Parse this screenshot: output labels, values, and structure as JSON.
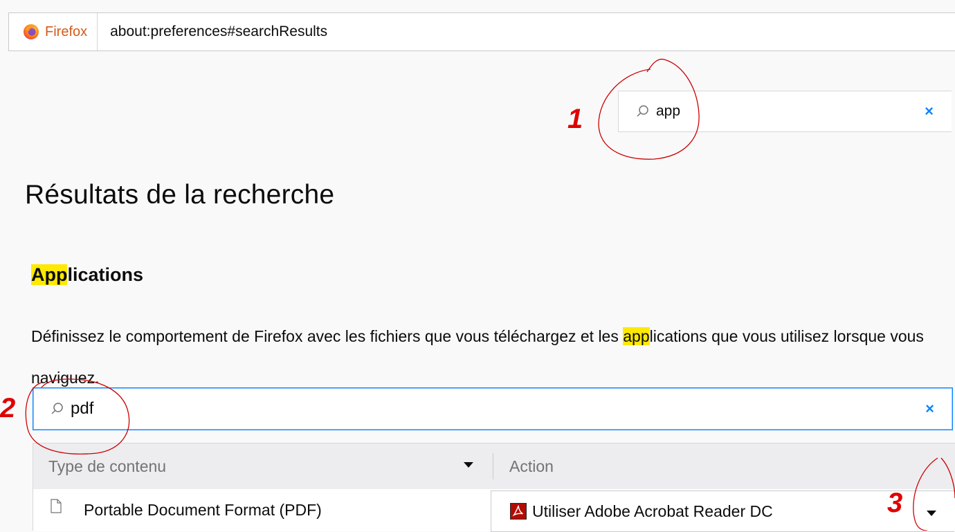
{
  "urlbar": {
    "identity_label": "Firefox",
    "url": "about:preferences#searchResults"
  },
  "top_search": {
    "value": "app",
    "icon": "search-icon",
    "clear_icon": "close-icon"
  },
  "page": {
    "heading": "Résultats de la recherche"
  },
  "section": {
    "title_highlight": "App",
    "title_rest": "lications",
    "description_part1": "Définissez le comportement de Firefox avec les fichiers que vous téléchargez et les ",
    "description_highlight": "app",
    "description_part2": "lications que vous utilisez lorsque vous naviguez."
  },
  "filter": {
    "value": "pdf",
    "icon": "search-icon",
    "clear_icon": "close-icon"
  },
  "table": {
    "headers": {
      "type": "Type de contenu",
      "action": "Action"
    },
    "rows": [
      {
        "type": "Portable Document Format (PDF)",
        "action": "Utiliser Adobe Acrobat Reader DC",
        "type_icon": "file-icon",
        "action_icon": "acrobat-icon"
      }
    ]
  },
  "annotations": [
    "1",
    "2",
    "3"
  ],
  "colors": {
    "highlight": "#ffe900",
    "accent": "#0a84ff",
    "annotation": "#e00000",
    "firefox_label": "#d45a1b"
  }
}
